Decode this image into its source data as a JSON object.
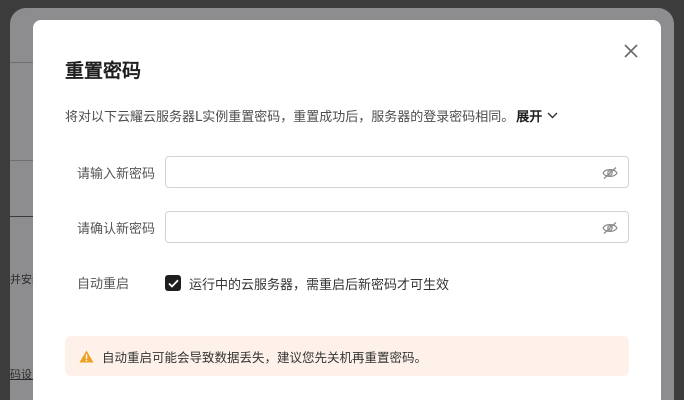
{
  "background": {
    "snippet_1": "并安装",
    "snippet_2": "码设置"
  },
  "dialog": {
    "title": "重置密码",
    "description": "将对以下云耀云服务器L实例重置密码，重置成功后，服务器的登录密码相同。",
    "expand_label": "展开",
    "new_password_label": "请输入新密码",
    "new_password_value": "",
    "confirm_password_label": "请确认新密码",
    "confirm_password_value": "",
    "auto_restart_label": "自动重启",
    "auto_restart_checked": true,
    "auto_restart_checkbox_text": "运行中的云服务器，需重启后新密码才可生效",
    "warning_text": "自动重启可能会导致数据丢失，建议您先关机再重置密码。"
  },
  "colors": {
    "warning_icon": "#f0a020",
    "warning_background": "#fdf1ea",
    "checkbox": "#1f1f1f"
  },
  "icons": {
    "close": "close-icon",
    "expand": "chevron-down-icon",
    "password_visibility": "eye-off-icon",
    "checkbox": "check-icon",
    "warning": "warning-triangle-icon"
  }
}
